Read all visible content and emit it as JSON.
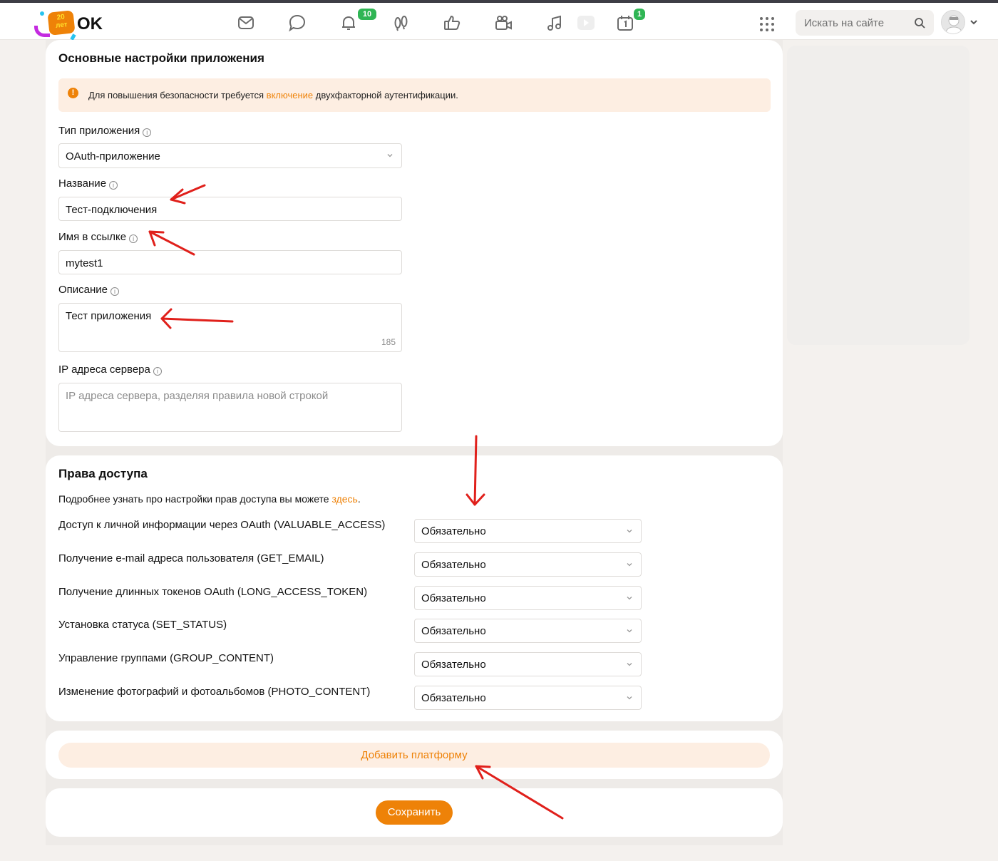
{
  "header": {
    "logo_badge_top": "20",
    "logo_badge_bottom": "лет",
    "logo_text": "OK",
    "notifications_count": "10",
    "events_count": "1",
    "search_placeholder": "Искать на сайте"
  },
  "basic_settings": {
    "title": "Основные настройки приложения",
    "alert": {
      "text_before": "Для повышения безопасности требуется ",
      "link": "включение",
      "text_after": " двухфакторной аутентификации."
    },
    "app_type_label": "Тип приложения",
    "app_type_value": "OAuth-приложение",
    "name_label": "Название",
    "name_value": "Тест-подключения",
    "link_name_label": "Имя в ссылке",
    "link_name_value": "mytest1",
    "description_label": "Описание",
    "description_value": "Тест приложения",
    "description_counter": "185",
    "ip_label": "IP адреса сервера",
    "ip_placeholder": "IP адреса сервера, разделяя правила новой строкой"
  },
  "permissions": {
    "title": "Права доступа",
    "intro_before": "Подробнее узнать про настройки прав доступа вы можете ",
    "intro_link": "здесь",
    "intro_after": ".",
    "items": [
      {
        "label": "Доступ к личной информации через OAuth (VALUABLE_ACCESS)",
        "value": "Обязательно"
      },
      {
        "label": "Получение e-mail адреса пользователя (GET_EMAIL)",
        "value": "Обязательно"
      },
      {
        "label": "Получение длинных токенов OAuth (LONG_ACCESS_TOKEN)",
        "value": "Обязательно"
      },
      {
        "label": "Установка статуса (SET_STATUS)",
        "value": "Обязательно"
      },
      {
        "label": "Управление группами (GROUP_CONTENT)",
        "value": "Обязательно"
      },
      {
        "label": "Изменение фотографий и фотоальбомов (PHOTO_CONTENT)",
        "value": "Обязательно"
      }
    ]
  },
  "actions": {
    "add_platform": "Добавить платформу",
    "save": "Сохранить"
  },
  "colors": {
    "accent": "#ee8208",
    "alert_bg": "#fdeee2",
    "badge_green": "#2fb554",
    "annotation_red": "#e0201b"
  },
  "icons": [
    "mail-icon",
    "chat-icon",
    "bell-icon",
    "guests-icon",
    "like-icon",
    "video-camera-icon",
    "music-icon",
    "video-play-icon",
    "calendar-icon",
    "apps-grid-icon",
    "search-icon",
    "chevron-down-icon",
    "info-icon",
    "alert-icon"
  ]
}
